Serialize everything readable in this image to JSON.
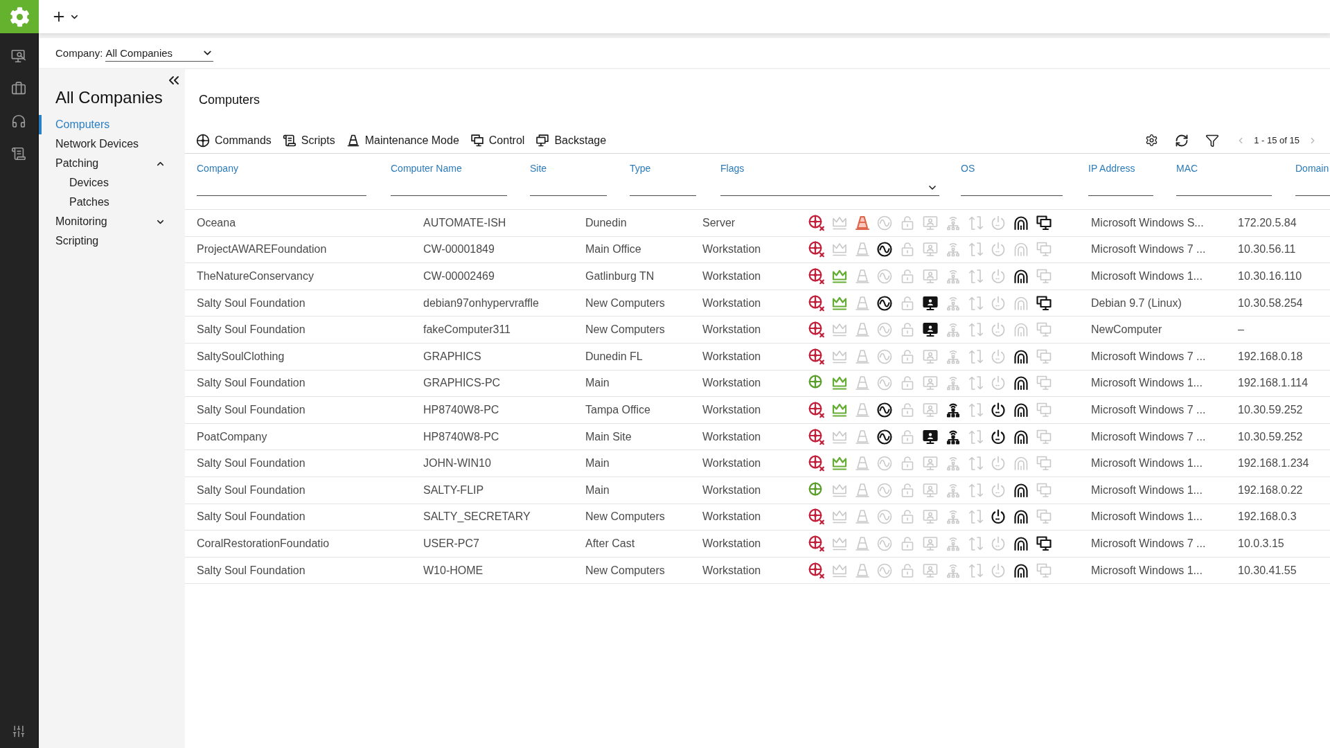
{
  "company_filter": {
    "label": "Company:",
    "value": "All Companies"
  },
  "sidebar": {
    "title": "All Companies",
    "items": [
      {
        "label": "Computers",
        "selected": true
      },
      {
        "label": "Network Devices",
        "selected": false
      },
      {
        "label": "Patching",
        "selected": false,
        "expanded": true,
        "children": [
          {
            "label": "Devices",
            "selected": false
          },
          {
            "label": "Patches",
            "selected": false
          }
        ]
      },
      {
        "label": "Monitoring",
        "selected": false,
        "expanded": false
      },
      {
        "label": "Scripting",
        "selected": false
      }
    ]
  },
  "page_title": "Computers",
  "toolbar": {
    "actions": [
      {
        "kind": "commands",
        "label": "Commands"
      },
      {
        "kind": "scripts",
        "label": "Scripts"
      },
      {
        "kind": "maintenance",
        "label": "Maintenance Mode"
      },
      {
        "kind": "control",
        "label": "Control"
      },
      {
        "kind": "backstage",
        "label": "Backstage"
      }
    ],
    "pagination": {
      "label": "1 - 15 of 15",
      "prev_disabled": true,
      "next_disabled": true
    }
  },
  "table": {
    "columns": [
      {
        "label": "Company",
        "dropdown": false
      },
      {
        "label": "Computer Name",
        "dropdown": false
      },
      {
        "label": "Site",
        "dropdown": false
      },
      {
        "label": "Type",
        "dropdown": false
      },
      {
        "label": "Flags",
        "dropdown": true
      },
      {
        "label": "OS",
        "dropdown": false
      },
      {
        "label": "IP Address",
        "dropdown": false
      },
      {
        "label": "MAC",
        "dropdown": false
      },
      {
        "label": "Domain",
        "dropdown": false
      }
    ],
    "rows": [
      {
        "company": "Oceana",
        "computer_name": "AUTOMATE-ISH",
        "site": "Dunedin",
        "type": "Server",
        "flags": [
          {
            "kind": "crosshair",
            "on": false
          },
          {
            "kind": "crown",
            "on": false
          },
          {
            "kind": "cone",
            "on": true
          },
          {
            "kind": "pulse",
            "on": false
          },
          {
            "kind": "lock",
            "on": false
          },
          {
            "kind": "monitor",
            "on": false
          },
          {
            "kind": "network",
            "on": false
          },
          {
            "kind": "sync",
            "on": false
          },
          {
            "kind": "power",
            "on": false
          },
          {
            "kind": "arch",
            "on": true
          },
          {
            "kind": "screens",
            "on": true
          }
        ],
        "os": "Microsoft Windows S...",
        "ip_address": "172.20.5.84"
      },
      {
        "company": "ProjectAWAREFoundation",
        "computer_name": "CW-00001849",
        "site": "Main Office",
        "type": "Workstation",
        "flags": [
          {
            "kind": "crosshair",
            "on": false
          },
          {
            "kind": "crown",
            "on": false
          },
          {
            "kind": "cone",
            "on": false
          },
          {
            "kind": "pulse",
            "on": true
          },
          {
            "kind": "lock",
            "on": false
          },
          {
            "kind": "monitor",
            "on": false
          },
          {
            "kind": "network",
            "on": false
          },
          {
            "kind": "sync",
            "on": false
          },
          {
            "kind": "power",
            "on": false
          },
          {
            "kind": "arch",
            "on": false
          },
          {
            "kind": "screens",
            "on": false
          }
        ],
        "os": "Microsoft Windows 7 ...",
        "ip_address": "10.30.56.11"
      },
      {
        "company": "TheNatureConservancy",
        "computer_name": "CW-00002469",
        "site": "Gatlinburg TN",
        "type": "Workstation",
        "flags": [
          {
            "kind": "crosshair",
            "on": false
          },
          {
            "kind": "crown",
            "on": true
          },
          {
            "kind": "cone",
            "on": false
          },
          {
            "kind": "pulse",
            "on": false
          },
          {
            "kind": "lock",
            "on": false
          },
          {
            "kind": "monitor",
            "on": false
          },
          {
            "kind": "network",
            "on": false
          },
          {
            "kind": "sync",
            "on": false
          },
          {
            "kind": "power",
            "on": false
          },
          {
            "kind": "arch",
            "on": true
          },
          {
            "kind": "screens",
            "on": false
          }
        ],
        "os": "Microsoft Windows 1...",
        "ip_address": "10.30.16.110"
      },
      {
        "company": "Salty Soul Foundation",
        "computer_name": "debian97onhypervraffle",
        "site": "New Computers",
        "type": "Workstation",
        "flags": [
          {
            "kind": "crosshair",
            "on": false
          },
          {
            "kind": "crown",
            "on": true
          },
          {
            "kind": "cone",
            "on": false
          },
          {
            "kind": "pulse",
            "on": true
          },
          {
            "kind": "lock",
            "on": false
          },
          {
            "kind": "monitor",
            "on": true
          },
          {
            "kind": "network",
            "on": false
          },
          {
            "kind": "sync",
            "on": false
          },
          {
            "kind": "power",
            "on": false
          },
          {
            "kind": "arch",
            "on": false
          },
          {
            "kind": "screens",
            "on": true
          }
        ],
        "os": "Debian 9.7 (Linux)",
        "ip_address": "10.30.58.254"
      },
      {
        "company": "Salty Soul Foundation",
        "computer_name": "fakeComputer311",
        "site": "New Computers",
        "type": "Workstation",
        "flags": [
          {
            "kind": "crosshair",
            "on": false
          },
          {
            "kind": "crown",
            "on": false
          },
          {
            "kind": "cone",
            "on": false
          },
          {
            "kind": "pulse",
            "on": false
          },
          {
            "kind": "lock",
            "on": false
          },
          {
            "kind": "monitor",
            "on": true
          },
          {
            "kind": "network",
            "on": false
          },
          {
            "kind": "sync",
            "on": false
          },
          {
            "kind": "power",
            "on": false
          },
          {
            "kind": "arch",
            "on": false
          },
          {
            "kind": "screens",
            "on": false
          }
        ],
        "os": "NewComputer",
        "ip_address": "–"
      },
      {
        "company": "SaltySoulClothing",
        "computer_name": "GRAPHICS",
        "site": "Dunedin FL",
        "type": "Workstation",
        "flags": [
          {
            "kind": "crosshair",
            "on": false
          },
          {
            "kind": "crown",
            "on": false
          },
          {
            "kind": "cone",
            "on": false
          },
          {
            "kind": "pulse",
            "on": false
          },
          {
            "kind": "lock",
            "on": false
          },
          {
            "kind": "monitor",
            "on": false
          },
          {
            "kind": "network",
            "on": false
          },
          {
            "kind": "sync",
            "on": false
          },
          {
            "kind": "power",
            "on": false
          },
          {
            "kind": "arch",
            "on": true
          },
          {
            "kind": "screens",
            "on": false
          }
        ],
        "os": "Microsoft Windows 7 ...",
        "ip_address": "192.168.0.18"
      },
      {
        "company": "Salty Soul Foundation",
        "computer_name": "GRAPHICS-PC",
        "site": "Main",
        "type": "Workstation",
        "flags": [
          {
            "kind": "crosshair",
            "on": true
          },
          {
            "kind": "crown",
            "on": true
          },
          {
            "kind": "cone",
            "on": false
          },
          {
            "kind": "pulse",
            "on": false
          },
          {
            "kind": "lock",
            "on": false
          },
          {
            "kind": "monitor",
            "on": false
          },
          {
            "kind": "network",
            "on": false
          },
          {
            "kind": "sync",
            "on": false
          },
          {
            "kind": "power",
            "on": false
          },
          {
            "kind": "arch",
            "on": true
          },
          {
            "kind": "screens",
            "on": false
          }
        ],
        "os": "Microsoft Windows 1...",
        "ip_address": "192.168.1.114"
      },
      {
        "company": "Salty Soul Foundation",
        "computer_name": "HP8740W8-PC",
        "site": "Tampa Office",
        "type": "Workstation",
        "flags": [
          {
            "kind": "crosshair",
            "on": false
          },
          {
            "kind": "crown",
            "on": true
          },
          {
            "kind": "cone",
            "on": false
          },
          {
            "kind": "pulse",
            "on": true
          },
          {
            "kind": "lock",
            "on": false
          },
          {
            "kind": "monitor",
            "on": false
          },
          {
            "kind": "network",
            "on": true
          },
          {
            "kind": "sync",
            "on": false
          },
          {
            "kind": "power",
            "on": true
          },
          {
            "kind": "arch",
            "on": true
          },
          {
            "kind": "screens",
            "on": false
          }
        ],
        "os": "Microsoft Windows 7 ...",
        "ip_address": "10.30.59.252"
      },
      {
        "company": "PoatCompany",
        "computer_name": "HP8740W8-PC",
        "site": "Main Site",
        "type": "Workstation",
        "flags": [
          {
            "kind": "crosshair",
            "on": false
          },
          {
            "kind": "crown",
            "on": false
          },
          {
            "kind": "cone",
            "on": false
          },
          {
            "kind": "pulse",
            "on": true
          },
          {
            "kind": "lock",
            "on": false
          },
          {
            "kind": "monitor",
            "on": true
          },
          {
            "kind": "network",
            "on": true
          },
          {
            "kind": "sync",
            "on": false
          },
          {
            "kind": "power",
            "on": true
          },
          {
            "kind": "arch",
            "on": true
          },
          {
            "kind": "screens",
            "on": false
          }
        ],
        "os": "Microsoft Windows 7 ...",
        "ip_address": "10.30.59.252"
      },
      {
        "company": "Salty Soul Foundation",
        "computer_name": "JOHN-WIN10",
        "site": "Main",
        "type": "Workstation",
        "flags": [
          {
            "kind": "crosshair",
            "on": false
          },
          {
            "kind": "crown",
            "on": true
          },
          {
            "kind": "cone",
            "on": false
          },
          {
            "kind": "pulse",
            "on": false
          },
          {
            "kind": "lock",
            "on": false
          },
          {
            "kind": "monitor",
            "on": false
          },
          {
            "kind": "network",
            "on": false
          },
          {
            "kind": "sync",
            "on": false
          },
          {
            "kind": "power",
            "on": false
          },
          {
            "kind": "arch",
            "on": false
          },
          {
            "kind": "screens",
            "on": false
          }
        ],
        "os": "Microsoft Windows 1...",
        "ip_address": "192.168.1.234"
      },
      {
        "company": "Salty Soul Foundation",
        "computer_name": "SALTY-FLIP",
        "site": "Main",
        "type": "Workstation",
        "flags": [
          {
            "kind": "crosshair",
            "on": true
          },
          {
            "kind": "crown",
            "on": false
          },
          {
            "kind": "cone",
            "on": false
          },
          {
            "kind": "pulse",
            "on": false
          },
          {
            "kind": "lock",
            "on": false
          },
          {
            "kind": "monitor",
            "on": false
          },
          {
            "kind": "network",
            "on": false
          },
          {
            "kind": "sync",
            "on": false
          },
          {
            "kind": "power",
            "on": false
          },
          {
            "kind": "arch",
            "on": true
          },
          {
            "kind": "screens",
            "on": false
          }
        ],
        "os": "Microsoft Windows 1...",
        "ip_address": "192.168.0.22"
      },
      {
        "company": "Salty Soul Foundation",
        "computer_name": "SALTY_SECRETARY",
        "site": "New Computers",
        "type": "Workstation",
        "flags": [
          {
            "kind": "crosshair",
            "on": false
          },
          {
            "kind": "crown",
            "on": false
          },
          {
            "kind": "cone",
            "on": false
          },
          {
            "kind": "pulse",
            "on": false
          },
          {
            "kind": "lock",
            "on": false
          },
          {
            "kind": "monitor",
            "on": false
          },
          {
            "kind": "network",
            "on": false
          },
          {
            "kind": "sync",
            "on": false
          },
          {
            "kind": "power",
            "on": true
          },
          {
            "kind": "arch",
            "on": true
          },
          {
            "kind": "screens",
            "on": false
          }
        ],
        "os": "Microsoft Windows 1...",
        "ip_address": "192.168.0.3"
      },
      {
        "company": "CoralRestorationFoundatio",
        "computer_name": "USER-PC7",
        "site": "After Cast",
        "type": "Workstation",
        "flags": [
          {
            "kind": "crosshair",
            "on": false
          },
          {
            "kind": "crown",
            "on": false
          },
          {
            "kind": "cone",
            "on": false
          },
          {
            "kind": "pulse",
            "on": false
          },
          {
            "kind": "lock",
            "on": false
          },
          {
            "kind": "monitor",
            "on": false
          },
          {
            "kind": "network",
            "on": false
          },
          {
            "kind": "sync",
            "on": false
          },
          {
            "kind": "power",
            "on": false
          },
          {
            "kind": "arch",
            "on": true
          },
          {
            "kind": "screens",
            "on": true
          }
        ],
        "os": "Microsoft Windows 7 ...",
        "ip_address": "10.0.3.15"
      },
      {
        "company": "Salty Soul Foundation",
        "computer_name": "W10-HOME",
        "site": "New Computers",
        "type": "Workstation",
        "flags": [
          {
            "kind": "crosshair",
            "on": false
          },
          {
            "kind": "crown",
            "on": false
          },
          {
            "kind": "cone",
            "on": false
          },
          {
            "kind": "pulse",
            "on": false
          },
          {
            "kind": "lock",
            "on": false
          },
          {
            "kind": "monitor",
            "on": false
          },
          {
            "kind": "network",
            "on": false
          },
          {
            "kind": "sync",
            "on": false
          },
          {
            "kind": "power",
            "on": false
          },
          {
            "kind": "arch",
            "on": true
          },
          {
            "kind": "screens",
            "on": false
          }
        ],
        "os": "Microsoft Windows 1...",
        "ip_address": "10.30.41.55"
      }
    ]
  }
}
